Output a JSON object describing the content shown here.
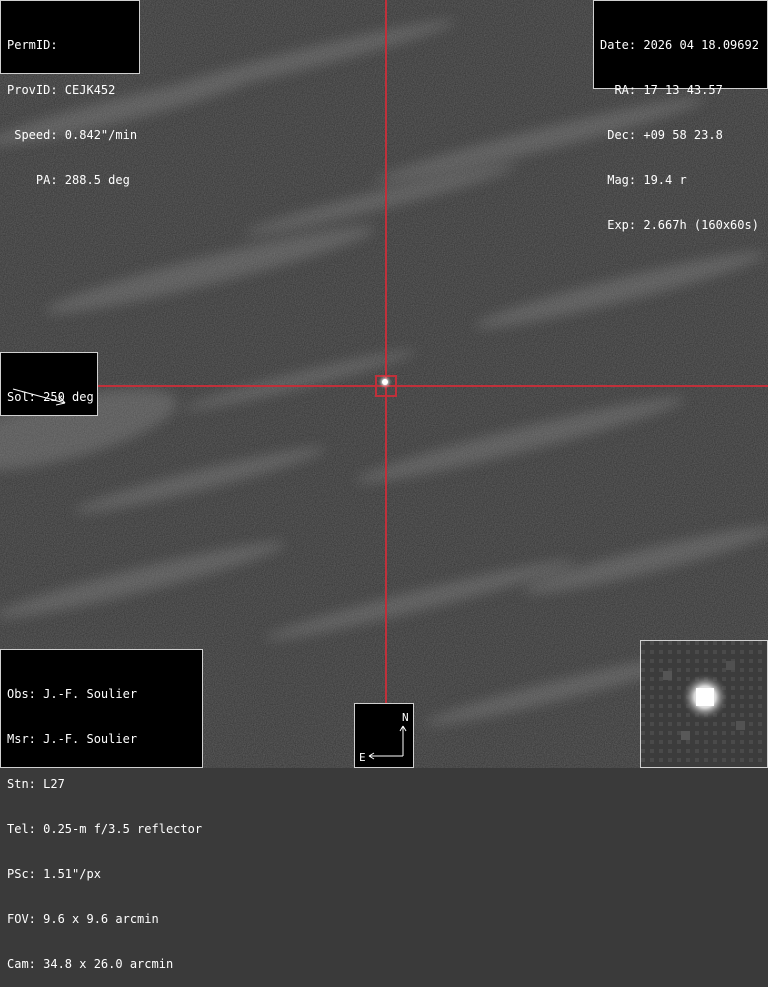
{
  "object_info": {
    "permid": "PermID:",
    "provid": "ProvID: CEJK452",
    "speed": " Speed: 0.842\"/min",
    "pa": "    PA: 288.5 deg"
  },
  "observation": {
    "date": "Date: 2026 04 18.09692",
    "ra": "  RA: 17 13 43.57",
    "dec": " Dec: +09 58 23.8",
    "mag": " Mag: 19.4 r",
    "exp": " Exp: 2.667h (160x60s)"
  },
  "solar": {
    "label": "Sol: 250 deg"
  },
  "credits": {
    "obs": "Obs: J.-F. Soulier",
    "msr": "Msr: J.-F. Soulier",
    "stn": "Stn: L27",
    "tel": "Tel: 0.25-m f/3.5 reflector",
    "psc": "PSc: 1.51\"/px",
    "fov": "FOV: 9.6 x 9.6 arcmin",
    "cam": "Cam: 34.8 x 26.0 arcmin"
  },
  "compass": {
    "north": "N",
    "east": "E"
  },
  "colors": {
    "crosshair": "#c0303a",
    "panel_bg": "#000000",
    "panel_border": "#d0d0d0",
    "text": "#ffffff"
  }
}
